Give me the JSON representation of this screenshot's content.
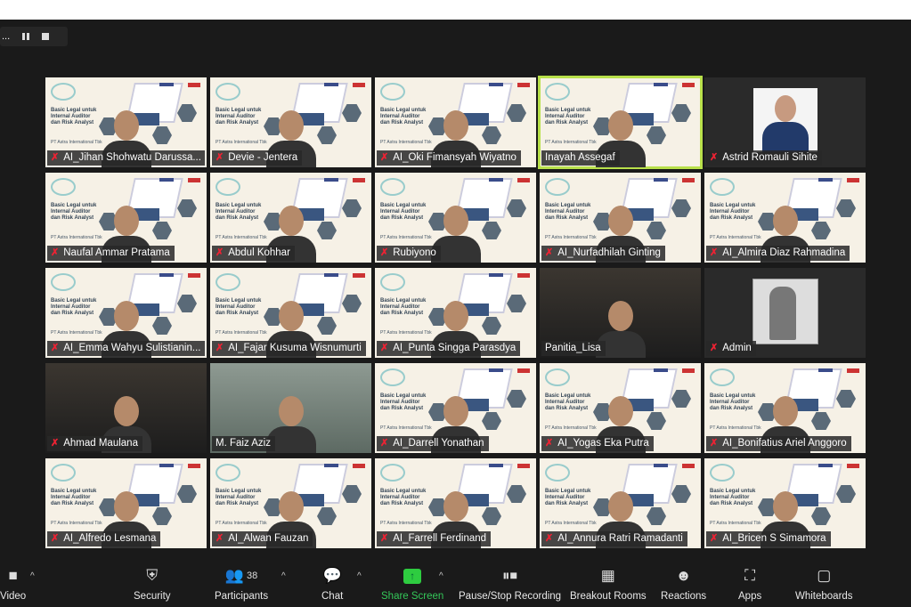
{
  "recording_bar": {
    "label": "..."
  },
  "slide": {
    "title": "Basic Legal untuk Internal Auditor dan Risk Analyst",
    "org": "PT Astra International Tbk"
  },
  "active_color": "#b8e04a",
  "tiles": [
    {
      "name": "AI_Jihan Shohwatu Darussa...",
      "kind": "slide",
      "muted": true
    },
    {
      "name": "Devie - Jentera",
      "kind": "slide",
      "muted": true
    },
    {
      "name": "AI_Oki Fimansyah Wiyatno",
      "kind": "slide",
      "muted": true
    },
    {
      "name": "Inayah Assegaf",
      "kind": "slide",
      "muted": false,
      "active": true
    },
    {
      "name": "Astrid Romauli Sihite",
      "kind": "photo",
      "muted": true
    },
    {
      "name": "Naufal Ammar Pratama",
      "kind": "slide",
      "muted": true
    },
    {
      "name": "Abdul Kohhar",
      "kind": "slide",
      "muted": true
    },
    {
      "name": "Rubiyono",
      "kind": "slide",
      "muted": true
    },
    {
      "name": "AI_Nurfadhilah Ginting",
      "kind": "slide",
      "muted": true
    },
    {
      "name": "AI_Almira Diaz Rahmadina",
      "kind": "slide",
      "muted": true
    },
    {
      "name": "AI_Emma Wahyu Sulistianin...",
      "kind": "slide",
      "muted": true
    },
    {
      "name": "AI_Fajar Kusuma Wisnumurti",
      "kind": "slide",
      "muted": true
    },
    {
      "name": "AI_Punta Singga Parasdya",
      "kind": "slide",
      "muted": true
    },
    {
      "name": "Panitia_Lisa",
      "kind": "camera",
      "muted": false
    },
    {
      "name": "Admin",
      "kind": "admin",
      "muted": true
    },
    {
      "name": "Ahmad Maulana",
      "kind": "camera",
      "muted": true
    },
    {
      "name": "M. Faiz Aziz",
      "kind": "camera2",
      "muted": false
    },
    {
      "name": "AI_Darrell Yonathan",
      "kind": "slide",
      "muted": true
    },
    {
      "name": "AI_Yogas Eka Putra",
      "kind": "slide",
      "muted": true
    },
    {
      "name": "AI_Bonifatius Ariel Anggoro",
      "kind": "slide",
      "muted": true
    },
    {
      "name": "AI_Alfredo Lesmana",
      "kind": "slide",
      "muted": true
    },
    {
      "name": "AI_Alwan Fauzan",
      "kind": "slide",
      "muted": true
    },
    {
      "name": "AI_Farrell Ferdinand",
      "kind": "slide",
      "muted": true
    },
    {
      "name": "AI_Annura Ratri Ramadanti",
      "kind": "slide",
      "muted": true
    },
    {
      "name": "AI_Bricen S Simamora",
      "kind": "slide",
      "muted": true
    }
  ],
  "toolbar": {
    "video": "Video",
    "security": "Security",
    "participants": "Participants",
    "participants_count": "38",
    "chat": "Chat",
    "share": "Share Screen",
    "recording": "Pause/Stop Recording",
    "breakout": "Breakout Rooms",
    "reactions": "Reactions",
    "apps": "Apps",
    "whiteboards": "Whiteboards"
  }
}
